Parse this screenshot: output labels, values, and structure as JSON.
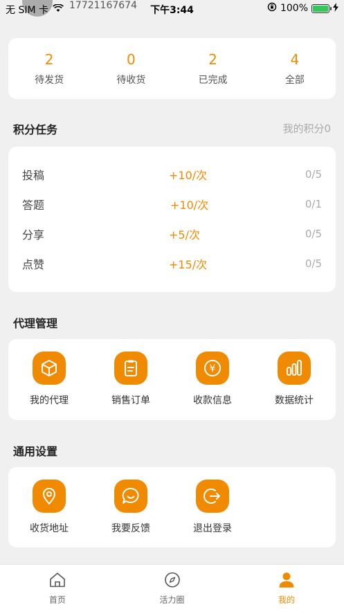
{
  "status_bar": {
    "carrier": "无 SIM 卡",
    "phone": "17721167674",
    "time": "下午3:44",
    "battery": "100%"
  },
  "orders": [
    {
      "count": "2",
      "label": "待发货"
    },
    {
      "count": "0",
      "label": "待收货"
    },
    {
      "count": "2",
      "label": "已完成"
    },
    {
      "count": "4",
      "label": "全部"
    }
  ],
  "points_section": {
    "title": "积分任务",
    "my_points": "我的积分0"
  },
  "tasks": [
    {
      "name": "投稿",
      "points": "+10/次",
      "progress": "0/5"
    },
    {
      "name": "答题",
      "points": "+10/次",
      "progress": "0/1"
    },
    {
      "name": "分享",
      "points": "+5/次",
      "progress": "0/5"
    },
    {
      "name": "点赞",
      "points": "+15/次",
      "progress": "0/5"
    }
  ],
  "agent_section": {
    "title": "代理管理",
    "items": [
      {
        "label": "我的代理",
        "icon": "cube-icon"
      },
      {
        "label": "销售订单",
        "icon": "clipboard-icon"
      },
      {
        "label": "收款信息",
        "icon": "yen-coin-icon"
      },
      {
        "label": "数据统计",
        "icon": "bar-chart-icon"
      }
    ]
  },
  "settings_section": {
    "title": "通用设置",
    "items": [
      {
        "label": "收货地址",
        "icon": "location-pin-icon"
      },
      {
        "label": "我要反馈",
        "icon": "chat-bubble-icon"
      },
      {
        "label": "退出登录",
        "icon": "logout-icon"
      }
    ]
  },
  "tabs": [
    {
      "label": "首页",
      "icon": "home-icon"
    },
    {
      "label": "活力圈",
      "icon": "compass-icon"
    },
    {
      "label": "我的",
      "icon": "person-icon"
    }
  ],
  "colors": {
    "accent": "#f08a00",
    "background": "#f0f0f0"
  }
}
